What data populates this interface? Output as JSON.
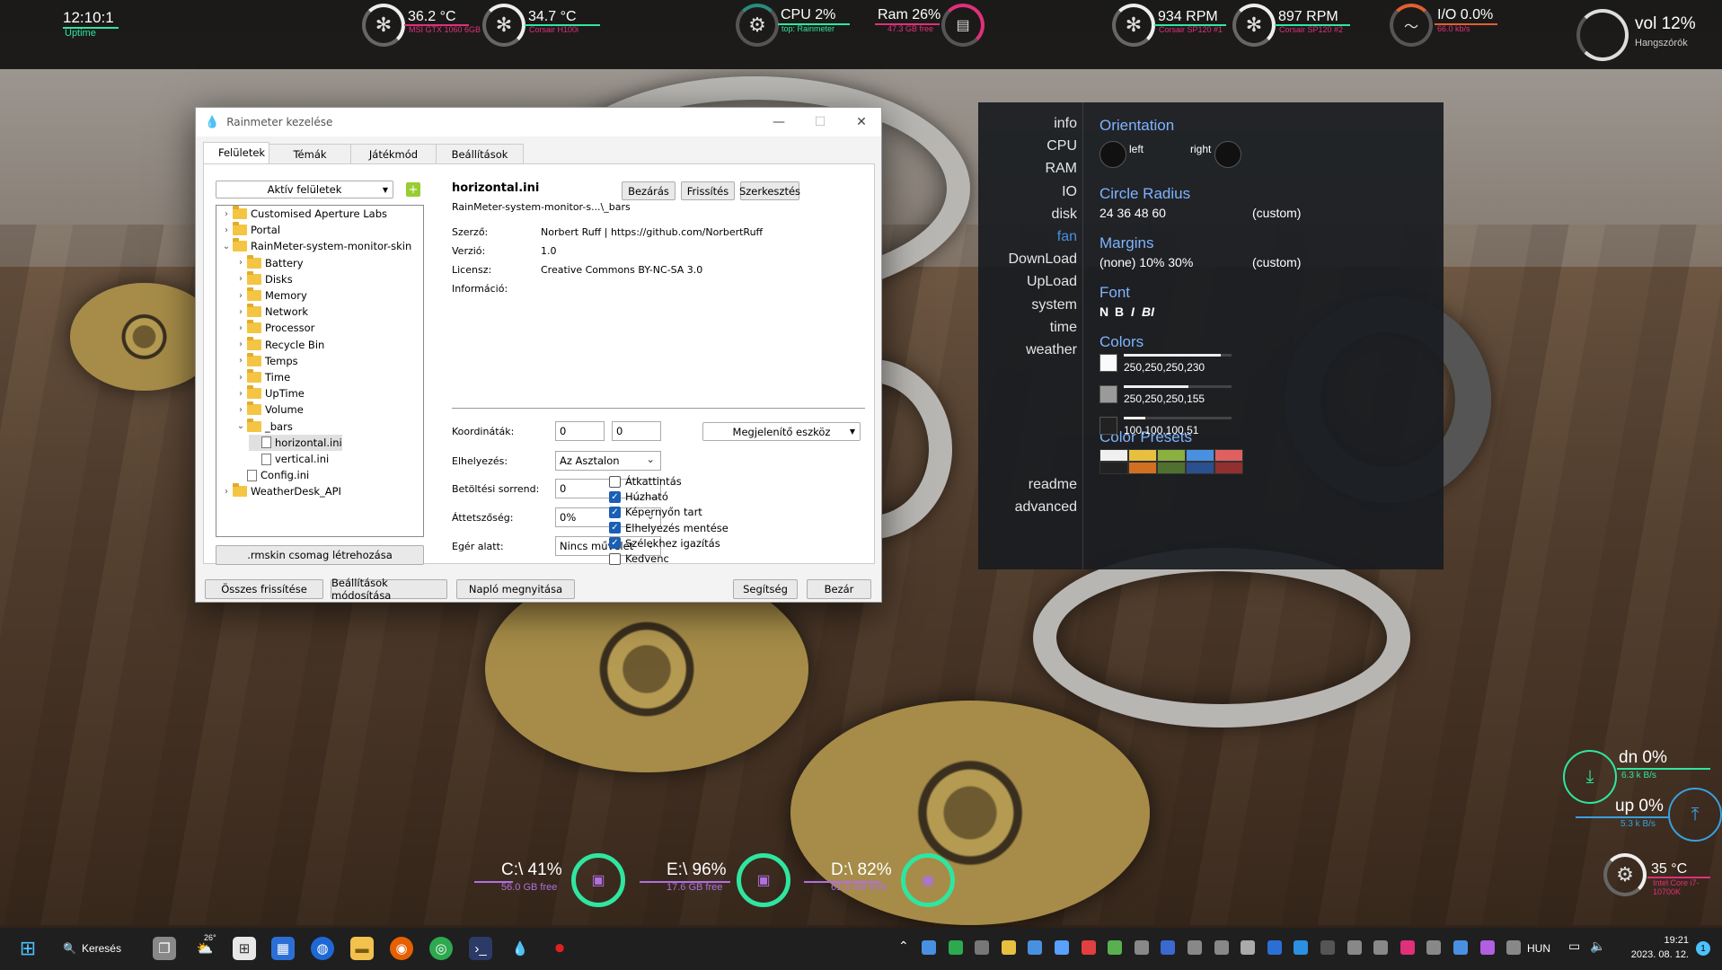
{
  "topbar": {
    "clock": "12:10:1",
    "uptime": "Uptime",
    "gpu_temp": "36.2 °C",
    "gpu_name": "MSI GTX 1060 6GB",
    "aio_temp": "34.7 °C",
    "aio_name": "Corsair H100i",
    "cpu": "CPU 2%",
    "cpu_top": "top: Rainmeter",
    "ram": "Ram 26%",
    "ram_free": "47.3 GB free",
    "fan1_rpm": "934 RPM",
    "fan1_name": "Corsair SP120 #1",
    "fan2_rpm": "897 RPM",
    "fan2_name": "Corsair SP120 #2",
    "io": "I/O 0.0%",
    "io_rate": "66.0 kb/s",
    "vol": "vol 12%",
    "vol_device": "Hangszórók"
  },
  "window": {
    "title": "Rainmeter kezelése",
    "tabs": [
      "Felületek",
      "Témák",
      "Játékmód",
      "Beállítások"
    ],
    "active_filter": "Aktív felületek",
    "tree": [
      {
        "label": "Customised Aperture Labs",
        "level": 0,
        "type": "folder",
        "arrow": "›"
      },
      {
        "label": "Portal",
        "level": 0,
        "type": "folder",
        "arrow": "›"
      },
      {
        "label": "RainMeter-system-monitor-skin",
        "level": 0,
        "type": "folder",
        "arrow": "⌄"
      },
      {
        "label": "Battery",
        "level": 1,
        "type": "folder",
        "arrow": "›"
      },
      {
        "label": "Disks",
        "level": 1,
        "type": "folder",
        "arrow": "›"
      },
      {
        "label": "Memory",
        "level": 1,
        "type": "folder",
        "arrow": "›"
      },
      {
        "label": "Network",
        "level": 1,
        "type": "folder",
        "arrow": "›"
      },
      {
        "label": "Processor",
        "level": 1,
        "type": "folder",
        "arrow": "›"
      },
      {
        "label": "Recycle Bin",
        "level": 1,
        "type": "folder",
        "arrow": "›"
      },
      {
        "label": "Temps",
        "level": 1,
        "type": "folder",
        "arrow": "›"
      },
      {
        "label": "Time",
        "level": 1,
        "type": "folder",
        "arrow": "›"
      },
      {
        "label": "UpTime",
        "level": 1,
        "type": "folder",
        "arrow": "›"
      },
      {
        "label": "Volume",
        "level": 1,
        "type": "folder",
        "arrow": "›"
      },
      {
        "label": "_bars",
        "level": 1,
        "type": "folder",
        "arrow": "⌄"
      },
      {
        "label": "horizontal.ini",
        "level": 2,
        "type": "file",
        "arrow": ""
      },
      {
        "label": "vertical.ini",
        "level": 2,
        "type": "file",
        "arrow": ""
      },
      {
        "label": "Config.ini",
        "level": 1,
        "type": "file",
        "arrow": ""
      },
      {
        "label": "WeatherDesk_API",
        "level": 0,
        "type": "folder",
        "arrow": "›"
      }
    ],
    "rmskin_button": ".rmskin csomag létrehozása",
    "skin_name": "horizontal.ini",
    "skin_path": "RainMeter-system-monitor-s...\\_bars",
    "btn_close_skin": "Bezárás",
    "btn_refresh": "Frissítés",
    "btn_edit": "Szerkesztés",
    "author_label": "Szerző:",
    "author": "Norbert Ruff | https://github.com/NorbertRuff",
    "version_label": "Verzió:",
    "version": "1.0",
    "license_label": "Licensz:",
    "license": "Creative Commons BY-NC-SA 3.0",
    "info_label": "Információ:",
    "coords_label": "Koordináták:",
    "coord_x": "0",
    "coord_y": "0",
    "display_dropdown": "Megjelenítő eszköz",
    "position_label": "Elhelyezés:",
    "position": "Az Asztalon",
    "load_order_label": "Betöltési sorrend:",
    "load_order": "0",
    "transparency_label": "Áttetszőség:",
    "transparency": "0%",
    "mouse_label": "Egér alatt:",
    "mouse_action": "Nincs művelet",
    "checkboxes": [
      {
        "label": "Átkattintás",
        "checked": false
      },
      {
        "label": "Húzható",
        "checked": true
      },
      {
        "label": "Képernyőn tart",
        "checked": true
      },
      {
        "label": "Elhelyezés mentése",
        "checked": true
      },
      {
        "label": "Szélekhez igazítás",
        "checked": true
      },
      {
        "label": "Kedvenc",
        "checked": false
      }
    ],
    "btn_refresh_all": "Összes frissítése",
    "btn_settings": "Beállítások módosítása",
    "btn_log": "Napló megnyitása",
    "btn_help": "Segítség",
    "btn_close": "Bezár"
  },
  "config": {
    "menu": [
      "info",
      "CPU",
      "RAM",
      "IO",
      "disk",
      "fan",
      "DownLoad",
      "UpLoad",
      "system",
      "time",
      "weather"
    ],
    "menu_active": "fan",
    "menu_bottom": [
      "readme",
      "advanced"
    ],
    "orientation_title": "Orientation",
    "orientation_left": "left",
    "orientation_right": "right",
    "radius_title": "Circle Radius",
    "radius_values": "24  36  48  60",
    "radius_custom": "(custom)",
    "margins_title": "Margins",
    "margins_values": "(none)  10%  30%",
    "margins_custom": "(custom)",
    "font_title": "Font",
    "font_values": [
      "N",
      "B",
      "I",
      "BI"
    ],
    "colors_title": "Colors",
    "colors": [
      {
        "value": "250,250,250,230",
        "swatch": "#fafafa",
        "level": 0.9
      },
      {
        "value": "250,250,250,155",
        "swatch": "#9a9a9a",
        "level": 0.6
      },
      {
        "value": "100,100,100,51",
        "swatch": "#222222",
        "level": 0.2
      }
    ],
    "presets_title": "Color Presets",
    "presets": [
      "#f0f0f0",
      "#e8c040",
      "#8ab040",
      "#4a90e0",
      "#e06060",
      "#222222",
      "#d07020",
      "#507030",
      "#2a5090",
      "#903030"
    ]
  },
  "disks": [
    {
      "label": "C:\\ 41%",
      "free": "56.0 GB free",
      "level": 0.41
    },
    {
      "label": "E:\\ 96%",
      "free": "17.6 GB free",
      "level": 0.96
    },
    {
      "label": "D:\\ 82%",
      "free": "61.5 GB free",
      "level": 0.82
    }
  ],
  "network": {
    "down": "dn 0%",
    "down_rate": "6.3 k B/s",
    "up": "up 0%",
    "up_rate": "5.3 k B/s",
    "cpu_temp": "35 °C",
    "cpu_name": "Intel Core i7-10700K"
  },
  "taskbar": {
    "search": "Keresés",
    "weather_temp": "26°",
    "lang": "HUN",
    "time": "19:21",
    "date": "2023. 08. 12.",
    "notifications": "1"
  },
  "colors": {
    "accent_green": "#2fe6a0",
    "accent_pink": "#e0307a",
    "accent_blue": "#7fb3ff"
  }
}
